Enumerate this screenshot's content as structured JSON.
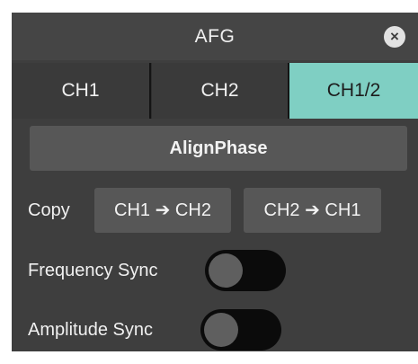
{
  "window": {
    "title": "AFG",
    "close_icon": "close-icon",
    "close_glyph": "×"
  },
  "tabs": [
    {
      "label": "CH1",
      "selected": false
    },
    {
      "label": "CH2",
      "selected": false
    },
    {
      "label": "CH1/2",
      "selected": true
    }
  ],
  "align_phase": {
    "label": "AlignPhase"
  },
  "copy": {
    "label": "Copy",
    "buttons": [
      {
        "label": "CH1 ➔ CH2"
      },
      {
        "label": "CH2 ➔ CH1"
      }
    ]
  },
  "frequency_sync": {
    "label": "Frequency Sync",
    "enabled": false
  },
  "amplitude_sync": {
    "label": "Amplitude Sync",
    "enabled": false
  },
  "colors": {
    "panel_background": "#3e3e3e",
    "tab_active": "#7fcfc3",
    "button_background": "#575757",
    "toggle_track": "#0b0b0b",
    "toggle_knob": "#5f5f5f"
  }
}
